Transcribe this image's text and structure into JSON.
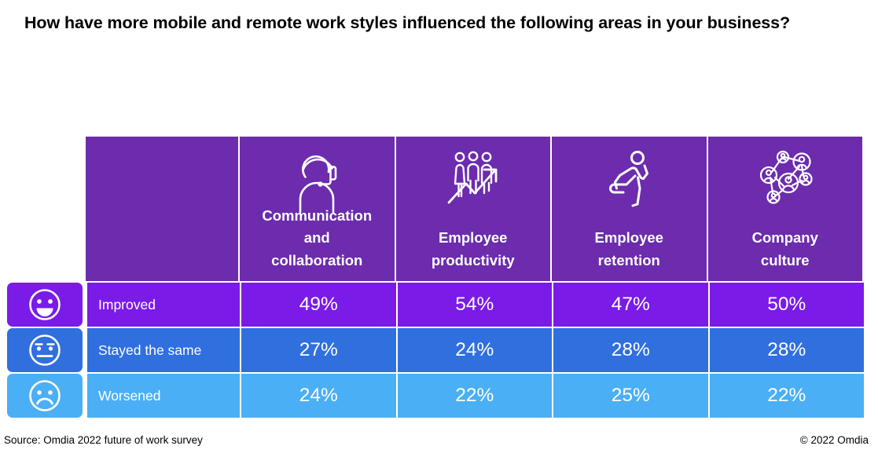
{
  "title": "How have more mobile and remote work styles influenced the following areas in your business?",
  "chart_data": {
    "type": "table",
    "title": "How have more mobile and remote work styles influenced the following areas in your business?",
    "categories": [
      "Communication and collaboration",
      "Employee productivity",
      "Employee retention",
      "Company culture"
    ],
    "row_labels": [
      "Improved",
      "Stayed the same",
      "Worsened"
    ],
    "series": [
      {
        "name": "Improved",
        "values": [
          49,
          54,
          47,
          50
        ]
      },
      {
        "name": "Stayed the same",
        "values": [
          27,
          24,
          28,
          28
        ]
      },
      {
        "name": "Worsened",
        "values": [
          24,
          22,
          25,
          22
        ]
      }
    ],
    "unit": "%",
    "xlabel": "",
    "ylabel": "",
    "legend_position": "left-row-labels",
    "grid": false
  },
  "columns": [
    {
      "icon": "headset-support-icon",
      "line1": "Communication",
      "line2": "and",
      "line3": "collaboration"
    },
    {
      "icon": "people-growth-chart-icon",
      "line1": "Employee",
      "line2": "productivity",
      "line3": ""
    },
    {
      "icon": "running-person-icon",
      "line1": "Employee",
      "line2": "retention",
      "line3": ""
    },
    {
      "icon": "people-network-icon",
      "line1": "Company",
      "line2": "culture",
      "line3": ""
    }
  ],
  "rows": [
    {
      "key": "improved",
      "label": "Improved",
      "face_icon": "happy-face-icon",
      "color": "#7A1BE8",
      "values": [
        "49%",
        "54%",
        "47%",
        "50%"
      ]
    },
    {
      "key": "same",
      "label": "Stayed the same",
      "face_icon": "neutral-face-icon",
      "color": "#306FDE",
      "values": [
        "27%",
        "24%",
        "28%",
        "28%"
      ]
    },
    {
      "key": "worsened",
      "label": "Worsened",
      "face_icon": "sad-face-icon",
      "color": "#4BAFF5",
      "values": [
        "24%",
        "22%",
        "25%",
        "22%"
      ]
    }
  ],
  "colors": {
    "header_purple": "#6C2CAD",
    "improved_purple": "#7A1BE8",
    "same_blue": "#306FDE",
    "worsened_light_blue": "#4BAFF5",
    "text_white": "#FFFFFF",
    "text_black": "#000000"
  },
  "footer": {
    "source": "Source: Omdia 2022 future of work survey",
    "copyright": "© 2022 Omdia"
  }
}
